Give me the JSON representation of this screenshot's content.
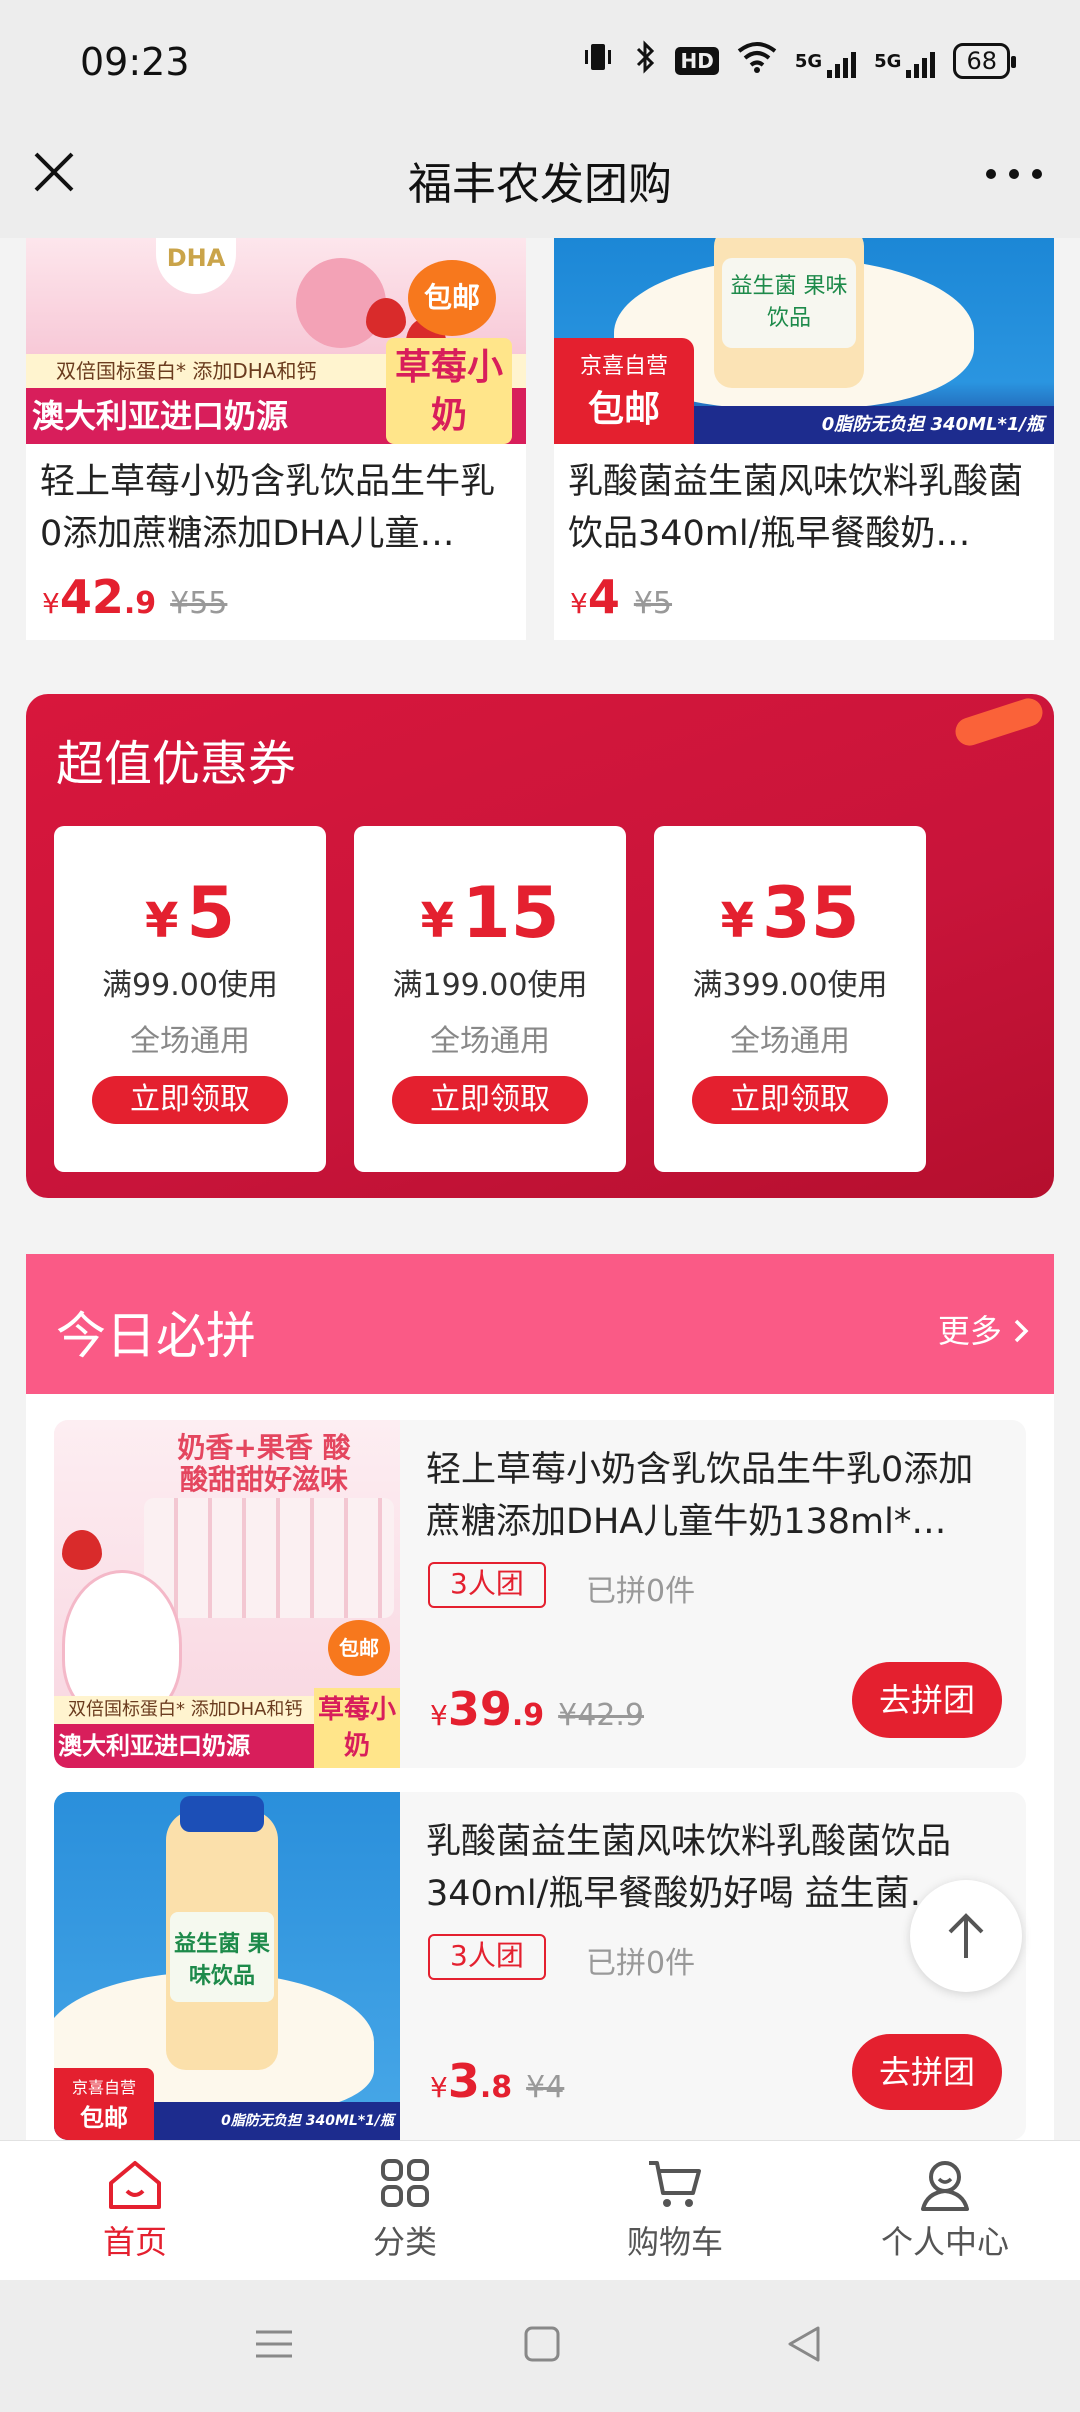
{
  "status_bar": {
    "time": "09:23",
    "hd_label": "HD",
    "net1_label": "5G",
    "net2_label": "5G",
    "battery": "68"
  },
  "title_bar": {
    "title": "福丰农发团购"
  },
  "top_products": [
    {
      "name": "轻上草莓小奶含乳饮品生牛乳0添加蔗糖添加DHA儿童…",
      "price_symbol": "¥",
      "price_int": "42",
      "price_dec": ".9",
      "original_price": "¥55",
      "image": {
        "band": "双倍国标蛋白* 添加DHA和钙",
        "banner": "澳大利亚进口奶源",
        "tag": "草莓小奶",
        "bubble": "包邮",
        "dha_label": "DHA"
      }
    },
    {
      "name": "乳酸菌益生菌风味饮料乳酸菌饮品340ml/瓶早餐酸奶…",
      "price_symbol": "¥",
      "price_int": "4",
      "price_dec": "",
      "original_price": "¥5",
      "image": {
        "jd_top": "京喜自营",
        "jd_bottom": "包邮",
        "strip": "0脂防无负担  340ML*1/瓶",
        "label": "益生菌 果味饮品"
      }
    }
  ],
  "coupons": {
    "title": "超值优惠券",
    "items": [
      {
        "symbol": "¥",
        "value": "5",
        "condition": "满99.00使用",
        "scope": "全场通用",
        "button": "立即领取"
      },
      {
        "symbol": "¥",
        "value": "15",
        "condition": "满199.00使用",
        "scope": "全场通用",
        "button": "立即领取"
      },
      {
        "symbol": "¥",
        "value": "35",
        "condition": "满399.00使用",
        "scope": "全场通用",
        "button": "立即领取"
      }
    ]
  },
  "today": {
    "title": "今日必拼",
    "more": "更多",
    "items": [
      {
        "name": "轻上草莓小奶含乳饮品生牛乳0添加蔗糖添加DHA儿童牛奶138ml*…",
        "group_tag": "3人团",
        "joined": "已拼0件",
        "price_symbol": "¥",
        "price_int": "39",
        "price_dec": ".9",
        "original_price": "¥42.9",
        "button": "去拼团",
        "image": {
          "slogan": "奶香+果香 酸酸甜甜好滋味",
          "band": "双倍国标蛋白* 添加DHA和钙",
          "banner": "澳大利亚进口奶源",
          "tag": "草莓小奶",
          "bubble": "包邮"
        }
      },
      {
        "name": "乳酸菌益生菌风味饮料乳酸菌饮品340ml/瓶早餐酸奶好喝 益生菌…",
        "group_tag": "3人团",
        "joined": "已拼0件",
        "price_symbol": "¥",
        "price_int": "3",
        "price_dec": ".8",
        "original_price": "¥4",
        "button": "去拼团",
        "image": {
          "label": "益生菌 果味饮品",
          "strip": "0脂防无负担  340ML*1/瓶",
          "jd_top": "京喜自营",
          "jd_bottom": "包邮"
        }
      }
    ]
  },
  "bottom_nav": [
    {
      "label": "首页",
      "icon": "home-icon",
      "active": true
    },
    {
      "label": "分类",
      "icon": "category-icon",
      "active": false
    },
    {
      "label": "购物车",
      "icon": "cart-icon",
      "active": false
    },
    {
      "label": "个人中心",
      "icon": "user-icon",
      "active": false
    }
  ],
  "colors": {
    "accent": "#e4202f",
    "coupon_bg": "#d8173c",
    "today_header": "#fa5a86",
    "status_bg": "#ededed"
  }
}
